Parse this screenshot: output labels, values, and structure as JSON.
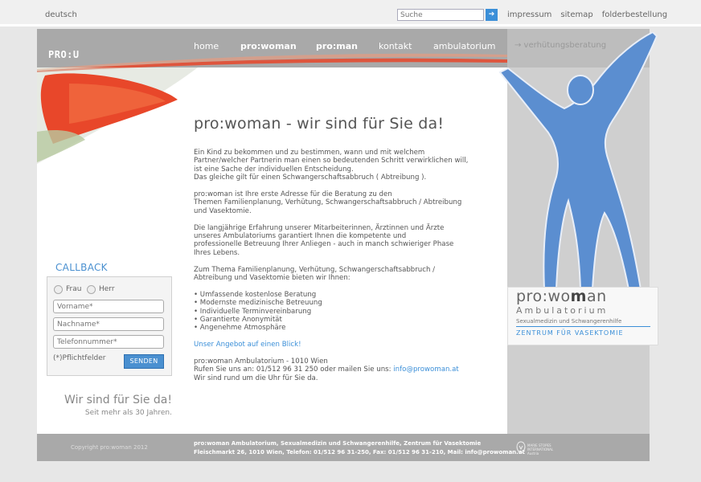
{
  "top": {
    "language": "deutsch",
    "search_placeholder": "Suche",
    "search_button_icon": "arrow-right-icon",
    "links": [
      "impressum",
      "sitemap",
      "folderbestellung"
    ]
  },
  "nav": {
    "logo": "PRO:U",
    "items": [
      "home",
      "pro:woman",
      "pro:man",
      "kontakt",
      "ambulatorium"
    ],
    "sub": "→ verhütungsberatung"
  },
  "main": {
    "heading": "pro:woman - wir sind für Sie da!",
    "p1_l1": "Ein Kind zu bekommen und zu bestimmen, wann und mit welchem",
    "p1_l2": "Partner/welcher Partnerin man einen so bedeutenden Schritt verwirklichen will,",
    "p1_l3": "ist eine Sache der individuellen Entscheidung.",
    "p1_l4": "Das gleiche gilt für einen Schwangerschaftsabbruch ( Abtreibung ).",
    "p2_l1": "pro:woman ist Ihre erste Adresse für die Beratung zu den",
    "p2_l2": "Themen Familienplanung, Verhütung, Schwangerschaftsabbruch / Abtreibung",
    "p2_l3": "und Vasektomie.",
    "p3_l1": "Die langjährige Erfahrung unserer Mitarbeiterinnen, Ärztinnen und Ärzte",
    "p3_l2": "unseres Ambulatoriums garantiert Ihnen die kompetente und",
    "p3_l3": "professionelle Betreuung Ihrer Anliegen - auch in manch schwieriger Phase",
    "p3_l4": "Ihres Lebens.",
    "p4_l1": "Zum Thema Familienplanung, Verhütung, Schwangerschaftsabbruch /",
    "p4_l2": "Abtreibung und Vasektomie bieten wir Ihnen:",
    "bullets": [
      "• Umfassende kostenlose Beratung",
      "• Modernste medizinische Betreuung",
      "• Individuelle Terminvereinbarung",
      "• Garantierte Anonymität",
      "• Angenehme Atmosphäre"
    ],
    "offer_link": "Unser Angebot auf einen Blick!",
    "addr_l1": "pro:woman Ambulatorium - 1010 Wien",
    "addr_l2_prefix": "Rufen Sie uns an: 01/512 96 31 250 oder mailen Sie uns: ",
    "email": "info@prowoman.at",
    "addr_l3": "Wir sind rund um die Uhr für Sie da."
  },
  "callback": {
    "title": "CALLBACK",
    "frau": "Frau",
    "herr": "Herr",
    "firstname_placeholder": "Vorname*",
    "lastname_placeholder": "Nachname*",
    "phone_placeholder": "Telefonnummer*",
    "required_note": "(*)Pflichtfelder",
    "send": "SENDEN"
  },
  "slogan": {
    "main": "Wir sind für Sie da!",
    "sub": "Seit mehr als 30 Jahren."
  },
  "brand": {
    "name_a": "pro:wo",
    "name_b": "m",
    "name_c": "an",
    "ambulatorium": "Ambulatorium",
    "subtitle": "Sexualmedizin und Schwangerenhilfe",
    "vasektomie": "ZENTRUM FÜR VASEKTOMIE"
  },
  "footer": {
    "copyright": "Copyright pro:woman 2012",
    "line1": "pro:woman Ambulatorium, Sexualmedizin und Schwangerenhilfe, Zentrum für Vasektomie",
    "line2": "Fleischmarkt 26, 1010 Wien, Telefon: 01/512 96 31-250, Fax: 01/512 96 31-210, Mail: info@prowoman.at",
    "partner_l1": "MARIE STOPES",
    "partner_l2": "INTERNATIONAL",
    "partner_l3": "Austria"
  },
  "colors": {
    "accent_blue": "#3b8fd8",
    "nav_gray": "#a9a9a9",
    "flower_red": "#e8472a"
  }
}
